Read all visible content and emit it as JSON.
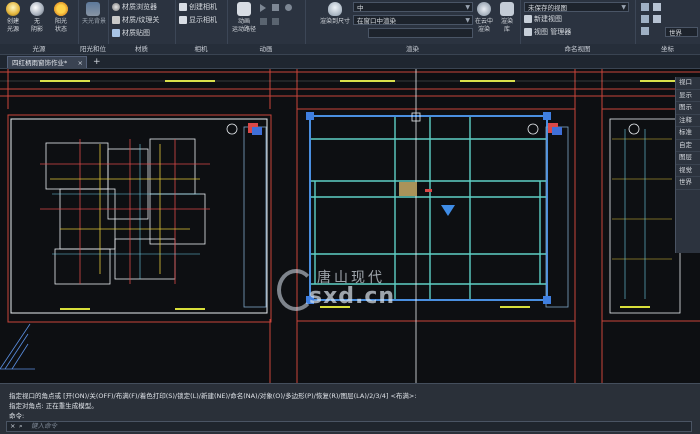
{
  "ribbon": {
    "light": {
      "create": "创建\n光源",
      "none": "无\n阴影",
      "sun": "阳光\n状态",
      "sky": "天光背景",
      "title": "光源"
    },
    "sunloc": {
      "title": "阳光和位置"
    },
    "materials": {
      "browser": "材质浏览器",
      "options": "材质/纹理关",
      "map": "材质贴图",
      "title": "材质"
    },
    "camera": {
      "create": "创建相机",
      "show": "显示相机",
      "title": "相机"
    },
    "animation": {
      "motion": "动画\n运动路径",
      "title": "动画"
    },
    "render": {
      "size": "渲染到尺寸",
      "quality": "中",
      "mode": "在窗口中渲染",
      "cloud": "在云中\n渲染",
      "library": "渲染\n库",
      "title": "渲染"
    },
    "views": {
      "saved": "未保存的视图",
      "new": "新建视图",
      "manager": "视图 管理器",
      "title": "命名视图"
    },
    "coords": {
      "world": "世界",
      "title": "坐标"
    }
  },
  "tabs": {
    "drawing": "四红柄雨窗饰作业*"
  },
  "viewport_panel": {
    "items": [
      "视口",
      "显示",
      "图示",
      "注释",
      "标准",
      "自定",
      "图层",
      "视觉",
      "世界"
    ]
  },
  "watermark": {
    "cn": "唐山现代",
    "en": "sxd.cn"
  },
  "command": {
    "line1": "指定视口的角点或 [开(ON)/关(OFF)/布满(F)/着色打印(S)/锁定(L)/新建(NE)/命名(NA)/对象(O)/多边形(P)/恢复(R)/图层(LA)/2/3/4] <布满>:",
    "line2": "指定对角点: 正在重生成模型。",
    "line3": "命令:",
    "placeholder": "键入命令"
  }
}
